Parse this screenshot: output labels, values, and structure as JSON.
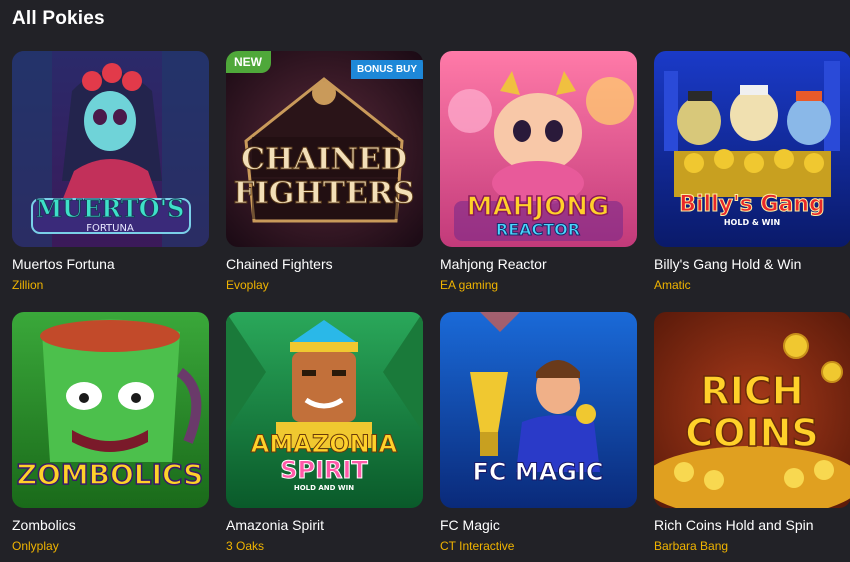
{
  "section": {
    "title": "All Pokies"
  },
  "games": [
    {
      "name": "Muertos Fortuna",
      "provider": "Zillion",
      "art": "muertos-fortuna-artwork",
      "logo_line1": "MUERTO'S",
      "logo_line2": "FORTUNA"
    },
    {
      "name": "Chained Fighters",
      "provider": "Evoplay",
      "art": "chained-fighters-artwork",
      "logo_line1": "CHAINED",
      "logo_line2": "FIGHTERS",
      "badge_new": "NEW",
      "badge_bonus": "BONUS BUY"
    },
    {
      "name": "Mahjong Reactor",
      "provider": "EA gaming",
      "art": "mahjong-reactor-artwork",
      "logo_line1": "MAHJONG",
      "logo_line2": "REACTOR"
    },
    {
      "name": "Billy's Gang Hold & Win",
      "provider": "Amatic",
      "art": "billys-gang-artwork",
      "logo_line1": "Billy's Gang",
      "logo_line2": "HOLD & WIN"
    },
    {
      "name": "Zombolics",
      "provider": "Onlyplay",
      "art": "zombolics-artwork",
      "logo_line1": "ZOMBOLICS"
    },
    {
      "name": "Amazonia Spirit",
      "provider": "3 Oaks",
      "art": "amazonia-spirit-artwork",
      "logo_line1": "AMAZONIA",
      "logo_line2": "SPIRIT",
      "logo_line3": "HOLD AND WIN"
    },
    {
      "name": "FC Magic",
      "provider": "CT Interactive",
      "art": "fc-magic-artwork",
      "logo_line1": "FC MAGIC"
    },
    {
      "name": "Rich Coins Hold and Spin",
      "provider": "Barbara Bang",
      "art": "rich-coins-artwork",
      "logo_line1": "RICH",
      "logo_line2": "COINS"
    }
  ],
  "colors": {
    "background": "#222227",
    "provider_text": "#f0b400",
    "badge_new": "#4fa83a",
    "badge_bonus": "#1e88d8"
  }
}
